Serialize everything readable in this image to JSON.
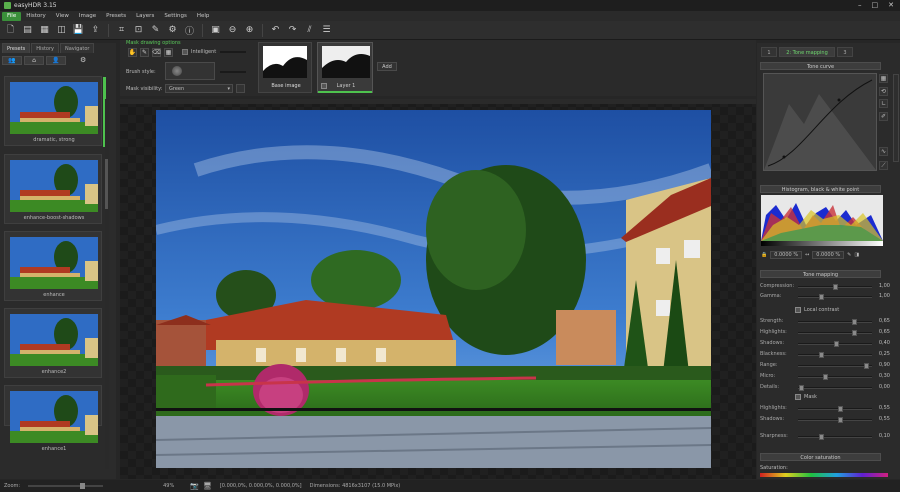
{
  "title": "easyHDR 3.15",
  "menu": [
    "File",
    "History",
    "View",
    "Image",
    "Presets",
    "Layers",
    "Settings",
    "Help"
  ],
  "left_tabs": [
    "Presets",
    "History",
    "Navigator"
  ],
  "presets": [
    {
      "label": "dramatic, strong"
    },
    {
      "label": "enhance-boost-shadows"
    },
    {
      "label": "enhance"
    },
    {
      "label": "enhance2"
    },
    {
      "label": "enhance1"
    }
  ],
  "mask": {
    "header": "Mask drawing options",
    "intelligent": "Intelligent",
    "brush_style": "Brush style:",
    "mask_visibility": "Mask visibility:",
    "mask_visibility_value": "Green"
  },
  "layers": {
    "base": "Base image",
    "layer1": "Layer 1",
    "add": "Add"
  },
  "right_tabs": [
    "1",
    "2: Tone mapping",
    "3"
  ],
  "tone_curve": "Tone curve",
  "histogram_header": "Histogram, black & white point",
  "hist_values": [
    "0.0000 %",
    "0.0000 %"
  ],
  "tone_mapping_header": "Tone mapping",
  "sliders_top": [
    {
      "name": "Compression:",
      "val": "1,00",
      "pos": 0.5
    },
    {
      "name": "Gamma:",
      "val": "1,00",
      "pos": 0.3
    }
  ],
  "local_contrast": "Local contrast",
  "sliders_lc": [
    {
      "name": "Strength:",
      "val": "0,65",
      "pos": 0.78
    },
    {
      "name": "Highlights:",
      "val": "0,65",
      "pos": 0.78
    },
    {
      "name": "Shadows:",
      "val": "0,40",
      "pos": 0.52
    },
    {
      "name": "Blackness:",
      "val": "0,25",
      "pos": 0.3
    },
    {
      "name": "Range:",
      "val": "0,90",
      "pos": 0.95
    },
    {
      "name": "Micro:",
      "val": "0,30",
      "pos": 0.36
    },
    {
      "name": "Details:",
      "val": "0,00",
      "pos": 0.01
    }
  ],
  "mask_check": "Mask",
  "sliders_mask": [
    {
      "name": "Highlights:",
      "val": "0,55",
      "pos": 0.58
    },
    {
      "name": "Shadows:",
      "val": "0,55",
      "pos": 0.58
    }
  ],
  "sharpness": {
    "name": "Sharpness:",
    "val": "0,10",
    "pos": 0.3
  },
  "color_saturation": "Color saturation",
  "saturation_label": "Saturation:",
  "status": {
    "zoom_label": "Zoom:",
    "zoom_pct": "49%",
    "values": "[0.000,0%, 0.000,0%, 0.000,0%]",
    "dimensions": "Dimensions: 4816x3107 (15.0 MPix)"
  }
}
